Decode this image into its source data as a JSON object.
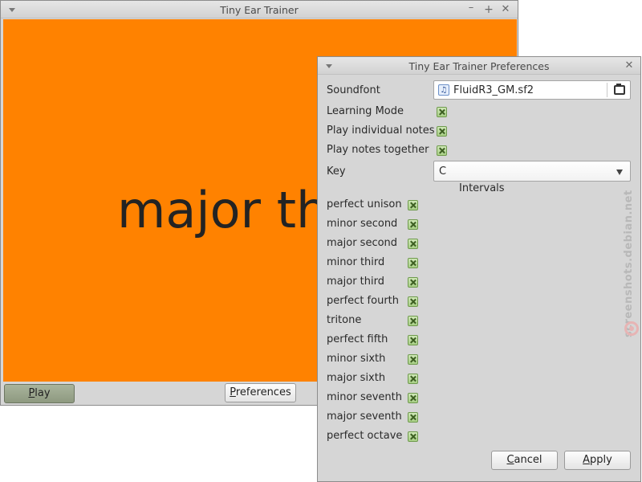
{
  "main_window": {
    "title": "Tiny Ear Trainer",
    "display_text": "major th",
    "background_color": "#ff8200",
    "play_button": {
      "label_mnemonic": "P",
      "label_rest": "lay"
    },
    "preferences_button": {
      "label_mnemonic": "P",
      "label_rest": "references"
    }
  },
  "preferences": {
    "title": "Tiny Ear Trainer Preferences",
    "soundfont": {
      "label": "Soundfont",
      "value": "FluidR3_GM.sf2"
    },
    "learning_mode": {
      "label": "Learning Mode",
      "checked": true
    },
    "play_individual": {
      "label": "Play individual notes",
      "checked": true
    },
    "play_together": {
      "label": "Play notes together",
      "checked": true
    },
    "key": {
      "label": "Key",
      "value": "C"
    },
    "intervals_header": "Intervals",
    "intervals": [
      {
        "label": "perfect unison",
        "checked": true
      },
      {
        "label": "minor second",
        "checked": true
      },
      {
        "label": "major second",
        "checked": true
      },
      {
        "label": "minor third",
        "checked": true
      },
      {
        "label": "major third",
        "checked": true
      },
      {
        "label": "perfect fourth",
        "checked": true
      },
      {
        "label": "tritone",
        "checked": true
      },
      {
        "label": "perfect fifth",
        "checked": true
      },
      {
        "label": "minor sixth",
        "checked": true
      },
      {
        "label": "major sixth",
        "checked": true
      },
      {
        "label": "minor seventh",
        "checked": true
      },
      {
        "label": "major seventh",
        "checked": true
      },
      {
        "label": "perfect octave",
        "checked": true
      }
    ],
    "cancel_button": {
      "label_mnemonic": "C",
      "label_rest": "ancel"
    },
    "apply_button": {
      "label_mnemonic": "A",
      "label_rest": "pply"
    }
  },
  "icons": {
    "window_menu": "chevron-down-icon",
    "minimize": "minimize-icon",
    "maximize": "maximize-icon",
    "close": "close-icon",
    "soundfont_file": "music-note-icon",
    "open_file": "folder-open-icon",
    "key_dropdown": "dropdown-arrow-icon"
  },
  "watermark": "screenshots.debian.net"
}
